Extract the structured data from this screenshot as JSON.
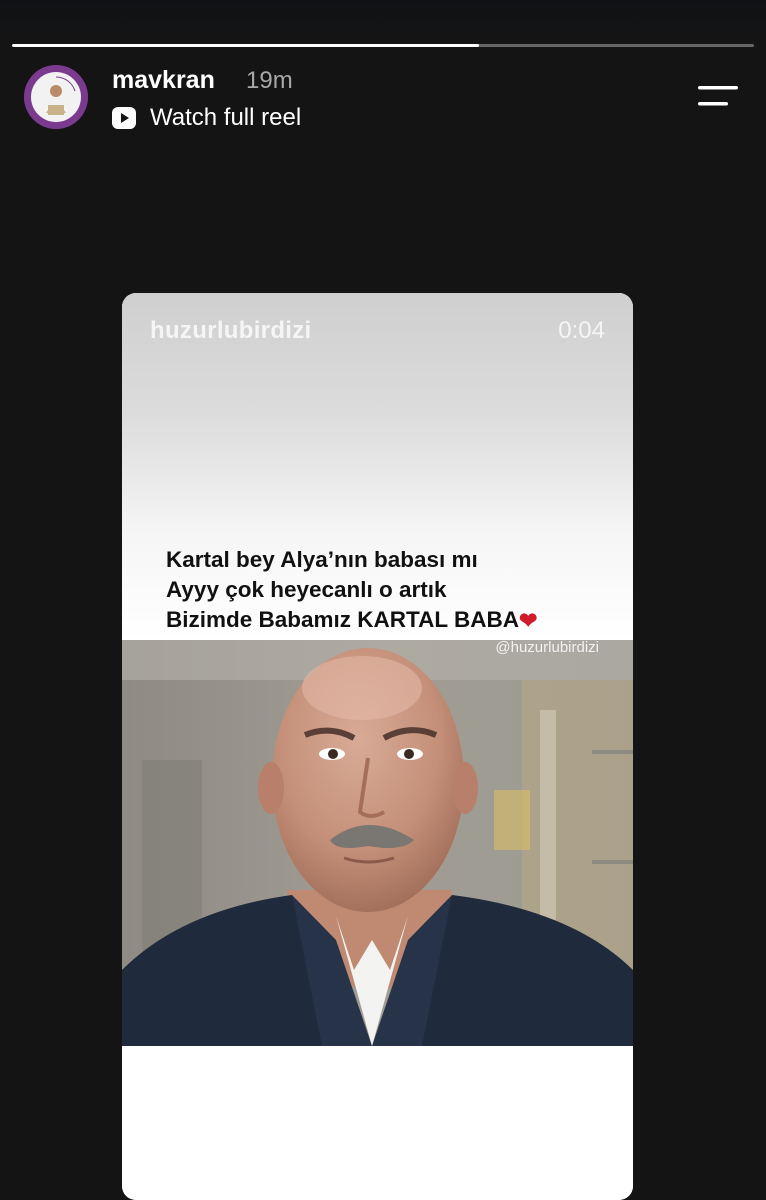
{
  "story": {
    "progress": 0.63,
    "username": "mavkran",
    "time_ago": "19m",
    "watch_label": "Watch full reel",
    "icons": {
      "play": "play-square-icon",
      "menu": "menu-lines-icon"
    }
  },
  "reel": {
    "username": "huzurlubirdizi",
    "duration": "0:04",
    "caption_lines": [
      "Kartal bey Alya’nın babası mı",
      "Ayyy çok heyecanlı o artık",
      "Bizimde Babamız KARTAL BABA"
    ],
    "caption_emoji": "❤",
    "watermark": "@huzurlubirdizi"
  },
  "colors": {
    "background": "#141414",
    "heart": "#d11a2a",
    "avatar_ring": "#7a3b8f",
    "muted_text": "#a8a8a8"
  }
}
